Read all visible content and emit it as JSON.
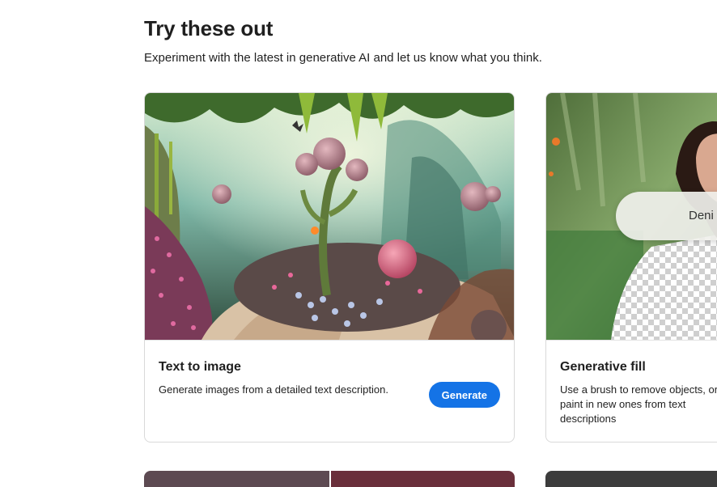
{
  "section": {
    "title": "Try these out",
    "subtitle": "Experiment with the latest in generative AI and let us know what you think."
  },
  "cards": [
    {
      "title": "Text to image",
      "description": "Generate images from a detailed text description.",
      "button_label": "Generate",
      "image": "fantasy-garden-image"
    },
    {
      "title": "Generative fill",
      "description": "Use a brush to remove objects, or paint in new ones from text descriptions",
      "pill_text": "Deni",
      "image": "woman-portrait-transparency-image"
    }
  ],
  "colors": {
    "accent": "#1473e6",
    "card_border": "#d9d9d9"
  }
}
